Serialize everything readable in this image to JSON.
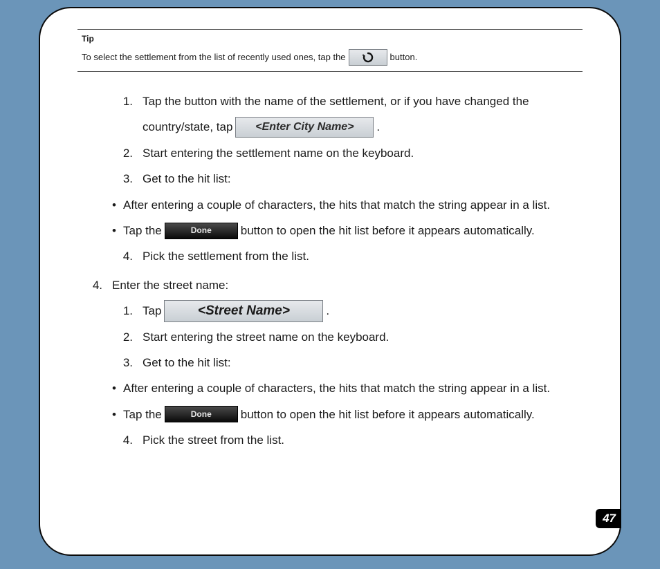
{
  "tip": {
    "title": "Tip",
    "before": "To select the settlement from the list of recently used ones, tap the",
    "after": " button.",
    "icon_name": "history-icon"
  },
  "steps": {
    "s1": {
      "num": "1.",
      "line1": "Tap the button with the name of the settlement, or if you have changed the",
      "line2_before": "country/state, tap ",
      "button_label": "<Enter City Name>",
      "line2_after": "."
    },
    "s2": {
      "num": "2.",
      "text": "Start entering the settlement name on the keyboard."
    },
    "s3": {
      "num": "3.",
      "text": "Get to the hit list:",
      "b1": "After entering a couple of characters, the hits that match the string appear in a list.",
      "b2_before": "Tap the ",
      "b2_button": "Done",
      "b2_after": "button to open the hit list before it appears automatically."
    },
    "s4": {
      "num": "4.",
      "text": "Pick the settlement from the list."
    }
  },
  "outer4": {
    "num": "4.",
    "text": "Enter the street name:",
    "s1": {
      "num": "1.",
      "before": "Tap ",
      "button_label": "<Street Name>",
      "after": "."
    },
    "s2": {
      "num": "2.",
      "text": "Start entering the street name on the keyboard."
    },
    "s3": {
      "num": "3.",
      "text": "Get to the hit list:",
      "b1": "After entering a couple of characters, the hits that match the string appear in a list.",
      "b2_before": "Tap the ",
      "b2_button": "Done",
      "b2_after": " button to open the hit list before it appears automatically."
    },
    "s4": {
      "num": "4.",
      "text": "Pick the street from the list."
    }
  },
  "page_number": "47",
  "bullet": "•"
}
